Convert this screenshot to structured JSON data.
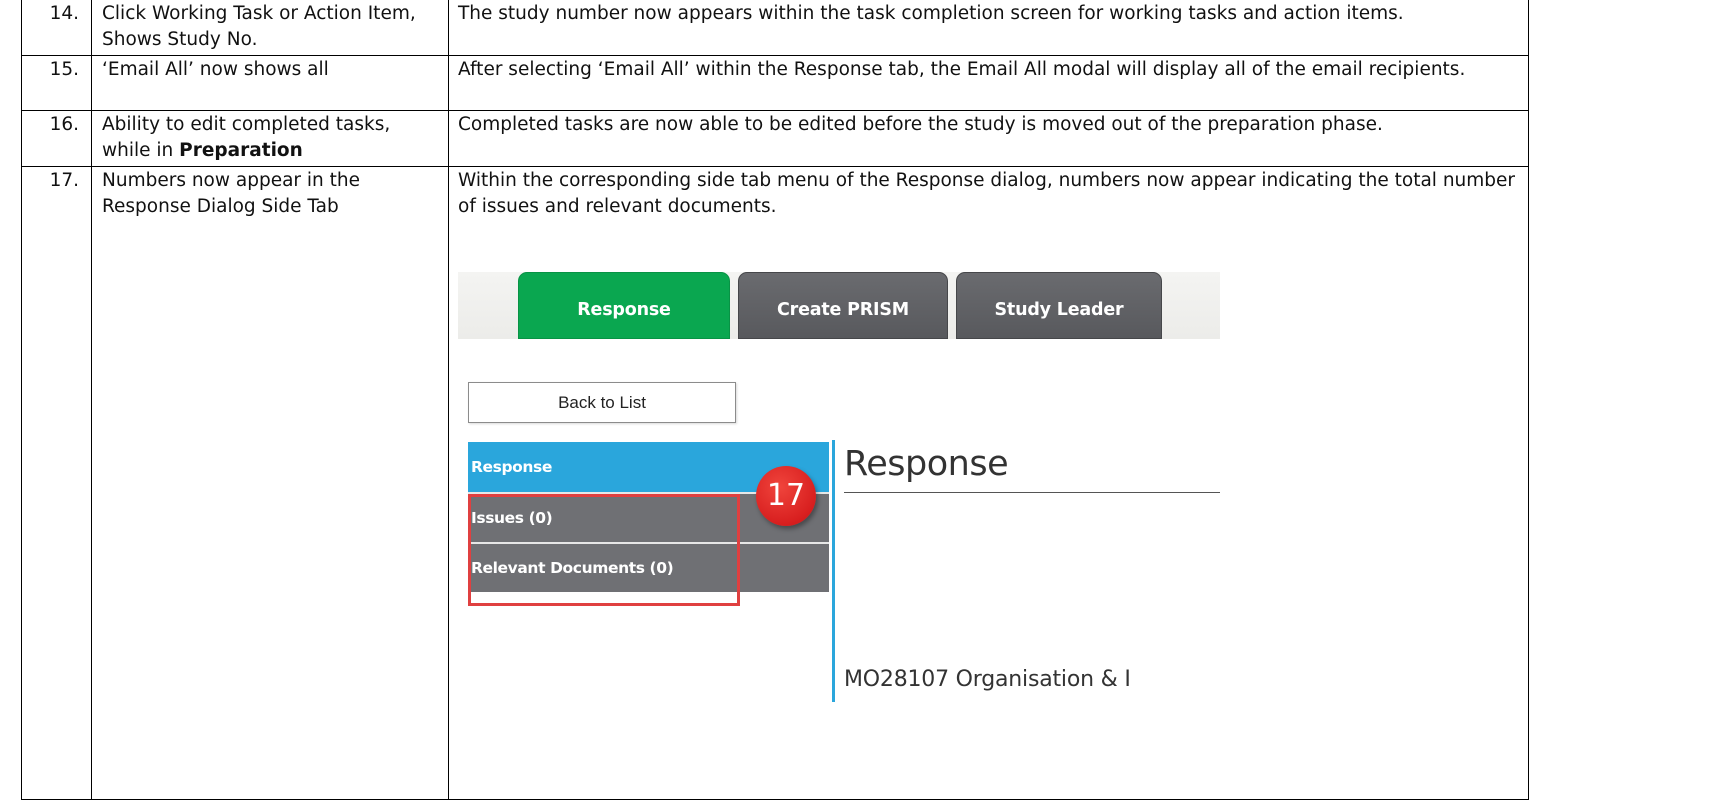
{
  "rows": [
    {
      "number": "14.",
      "feature": "Click Working Task or Action Item, Shows Study No.",
      "description": "The study number now appears within the task completion screen for working tasks and action items."
    },
    {
      "number": "15.",
      "feature": "‘Email All’ now shows all",
      "description": "After selecting ‘Email All’ within the Response tab, the Email All modal will display all of the email recipients."
    },
    {
      "number": "16.",
      "feature_prefix": "Ability to edit completed tasks, while in ",
      "feature_bold": "Preparation",
      "description": "Completed tasks are now able to be edited before the study is moved out of the preparation phase."
    },
    {
      "number": "17.",
      "feature": "Numbers now appear in the Response Dialog Side Tab",
      "description": "Within the corresponding side tab menu of the Response dialog, numbers now appear indicating the total number of issues and relevant documents."
    }
  ],
  "screenshot": {
    "tabs": [
      "Response",
      "Create PRISM",
      "Study Leader"
    ],
    "back_button": "Back to List",
    "side_nav": [
      "Response",
      "Issues (0)",
      "Relevant Documents (0)"
    ],
    "heading": "Response",
    "study_line": "MO28107   Organisation & I",
    "badge": "17",
    "colors": {
      "active_tab": "#0aa750",
      "inactive_tab": "#5f6064",
      "side_active": "#2aa6dc",
      "side_grey": "#6f7074",
      "highlight": "#e04040"
    }
  }
}
